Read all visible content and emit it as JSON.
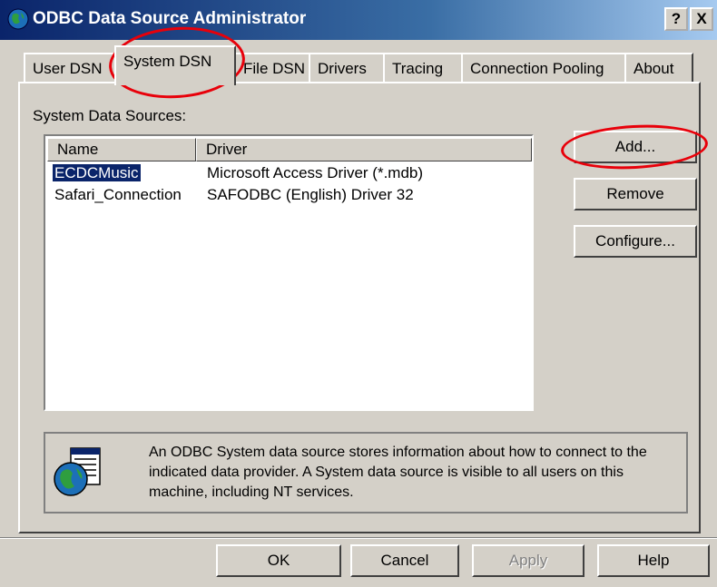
{
  "window": {
    "title": "ODBC Data Source Administrator",
    "help_button": "?",
    "close_button": "X"
  },
  "tabs": [
    {
      "label": "User DSN",
      "active": false
    },
    {
      "label": "System DSN",
      "active": true
    },
    {
      "label": "File DSN",
      "active": false
    },
    {
      "label": "Drivers",
      "active": false
    },
    {
      "label": "Tracing",
      "active": false
    },
    {
      "label": "Connection Pooling",
      "active": false
    },
    {
      "label": "About",
      "active": false
    }
  ],
  "system_data_sources": {
    "label": "System Data Sources:",
    "columns": [
      "Name",
      "Driver"
    ],
    "rows": [
      {
        "name": "ECDCMusic",
        "driver": "Microsoft Access Driver (*.mdb)",
        "selected": true
      },
      {
        "name": "Safari_Connection",
        "driver": "SAFODBC (English) Driver 32",
        "selected": false
      }
    ]
  },
  "actions": {
    "add": "Add...",
    "remove": "Remove",
    "configure": "Configure..."
  },
  "info": {
    "text": "An ODBC System data source stores information about how to connect to the indicated data provider.  A System data source is visible to all users on this machine, including NT services."
  },
  "footer": {
    "ok": "OK",
    "cancel": "Cancel",
    "apply": "Apply",
    "help": "Help"
  },
  "annotation_color": "#e8000a",
  "selection_color": "#0a246a"
}
